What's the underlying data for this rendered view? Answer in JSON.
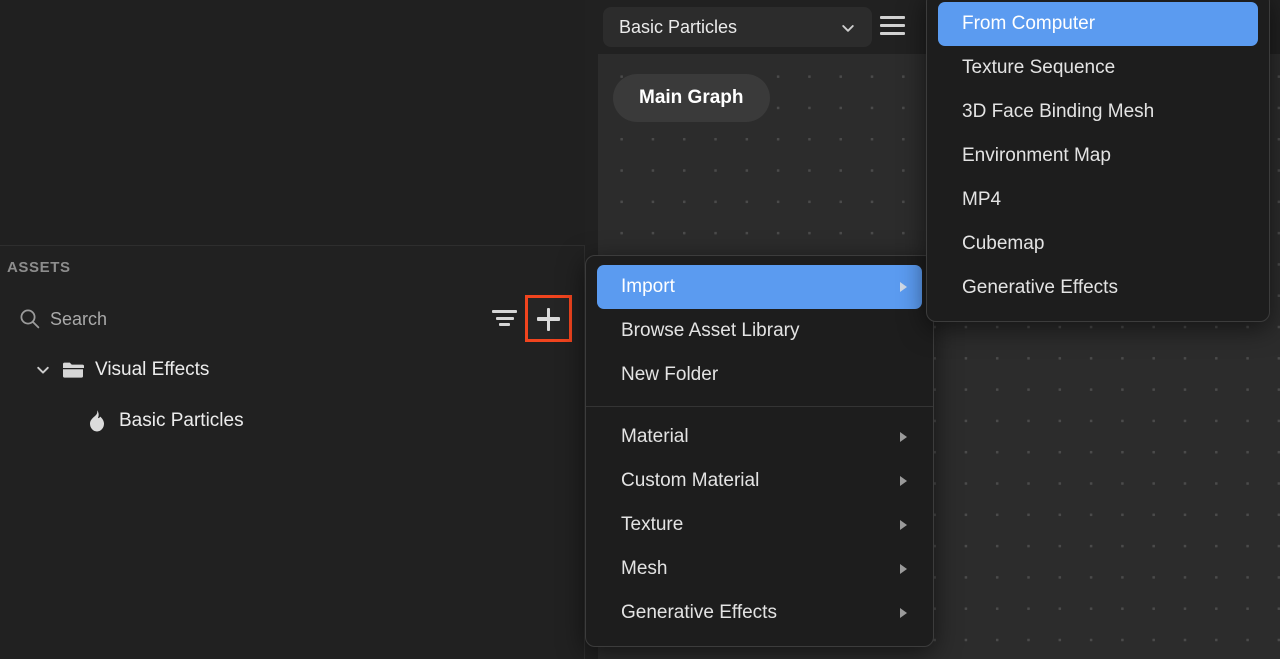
{
  "left_panel": {
    "header": "ASSETS",
    "search": {
      "placeholder": "Search",
      "value": "",
      "icon": "search-icon"
    },
    "filter_icon": "filter-icon",
    "add_icon": "plus-icon",
    "tree": [
      {
        "label": "Visual Effects",
        "icon": "folder-icon",
        "chevron": "chevron-down-icon",
        "depth": 1,
        "expanded": true
      },
      {
        "label": "Basic Particles",
        "icon": "flame-icon",
        "depth": 2,
        "expanded": false
      }
    ]
  },
  "graph_panel": {
    "asset_selector": {
      "value": "Basic Particles",
      "chevron": "chevron-down-icon"
    },
    "menu_icon": "hamburger-menu-icon",
    "node_label": "Main Graph"
  },
  "context_menu": {
    "items": [
      {
        "label": "Import",
        "has_submenu": true,
        "selected": true
      },
      {
        "label": "Browse Asset Library",
        "has_submenu": false,
        "selected": false
      },
      {
        "label": "New Folder",
        "has_submenu": false,
        "selected": false
      }
    ],
    "items_after_separator": [
      {
        "label": "Material",
        "has_submenu": true,
        "selected": false
      },
      {
        "label": "Custom Material",
        "has_submenu": true,
        "selected": false
      },
      {
        "label": "Texture",
        "has_submenu": true,
        "selected": false
      },
      {
        "label": "Mesh",
        "has_submenu": true,
        "selected": false
      },
      {
        "label": "Generative Effects",
        "has_submenu": true,
        "selected": false
      }
    ]
  },
  "submenu": {
    "items": [
      {
        "label": "From Computer",
        "selected": true
      },
      {
        "label": "Texture Sequence",
        "selected": false
      },
      {
        "label": "3D Face Binding Mesh",
        "selected": false
      },
      {
        "label": "Environment Map",
        "selected": false
      },
      {
        "label": "MP4",
        "selected": false
      },
      {
        "label": "Cubemap",
        "selected": false
      },
      {
        "label": "Generative Effects",
        "selected": false
      }
    ]
  },
  "colors": {
    "accent_blue": "#5b9bf0",
    "highlight_red": "#f1441e",
    "panel_bg": "#212121",
    "menu_bg": "#1d1d1d",
    "canvas_bg": "#2c2c2c"
  }
}
